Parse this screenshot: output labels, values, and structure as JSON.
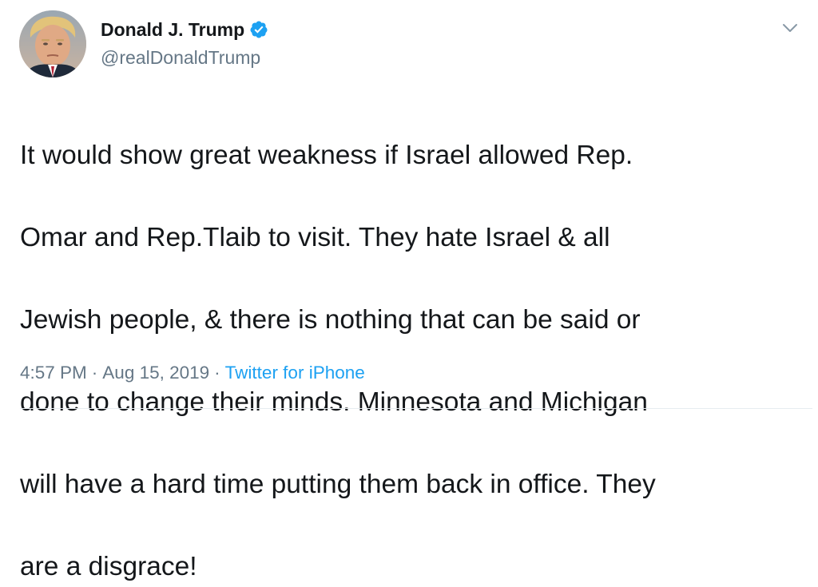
{
  "user": {
    "display_name": "Donald J. Trump",
    "screen_name": "@realDonaldTrump",
    "verified_icon": "verified-badge-icon",
    "avatar": "profile-photo"
  },
  "tweet": {
    "text_lines": [
      "It would show great weakness if Israel allowed Rep.",
      "Omar and Rep.Tlaib to visit. They hate Israel & all",
      "Jewish people, & there is nothing that can be said or",
      "done to change their minds. Minnesota and Michigan",
      "will have a hard time putting them back in office. They",
      "are a disgrace!"
    ],
    "time": "4:57 PM",
    "separator": "·",
    "date": "Aug 15, 2019",
    "source": "Twitter for iPhone"
  },
  "menu": {
    "caret_icon": "chevron-down-icon"
  },
  "colors": {
    "text": "#14171a",
    "secondary": "#657786",
    "accent": "#1da1f2",
    "divider": "#e6ecf0"
  }
}
